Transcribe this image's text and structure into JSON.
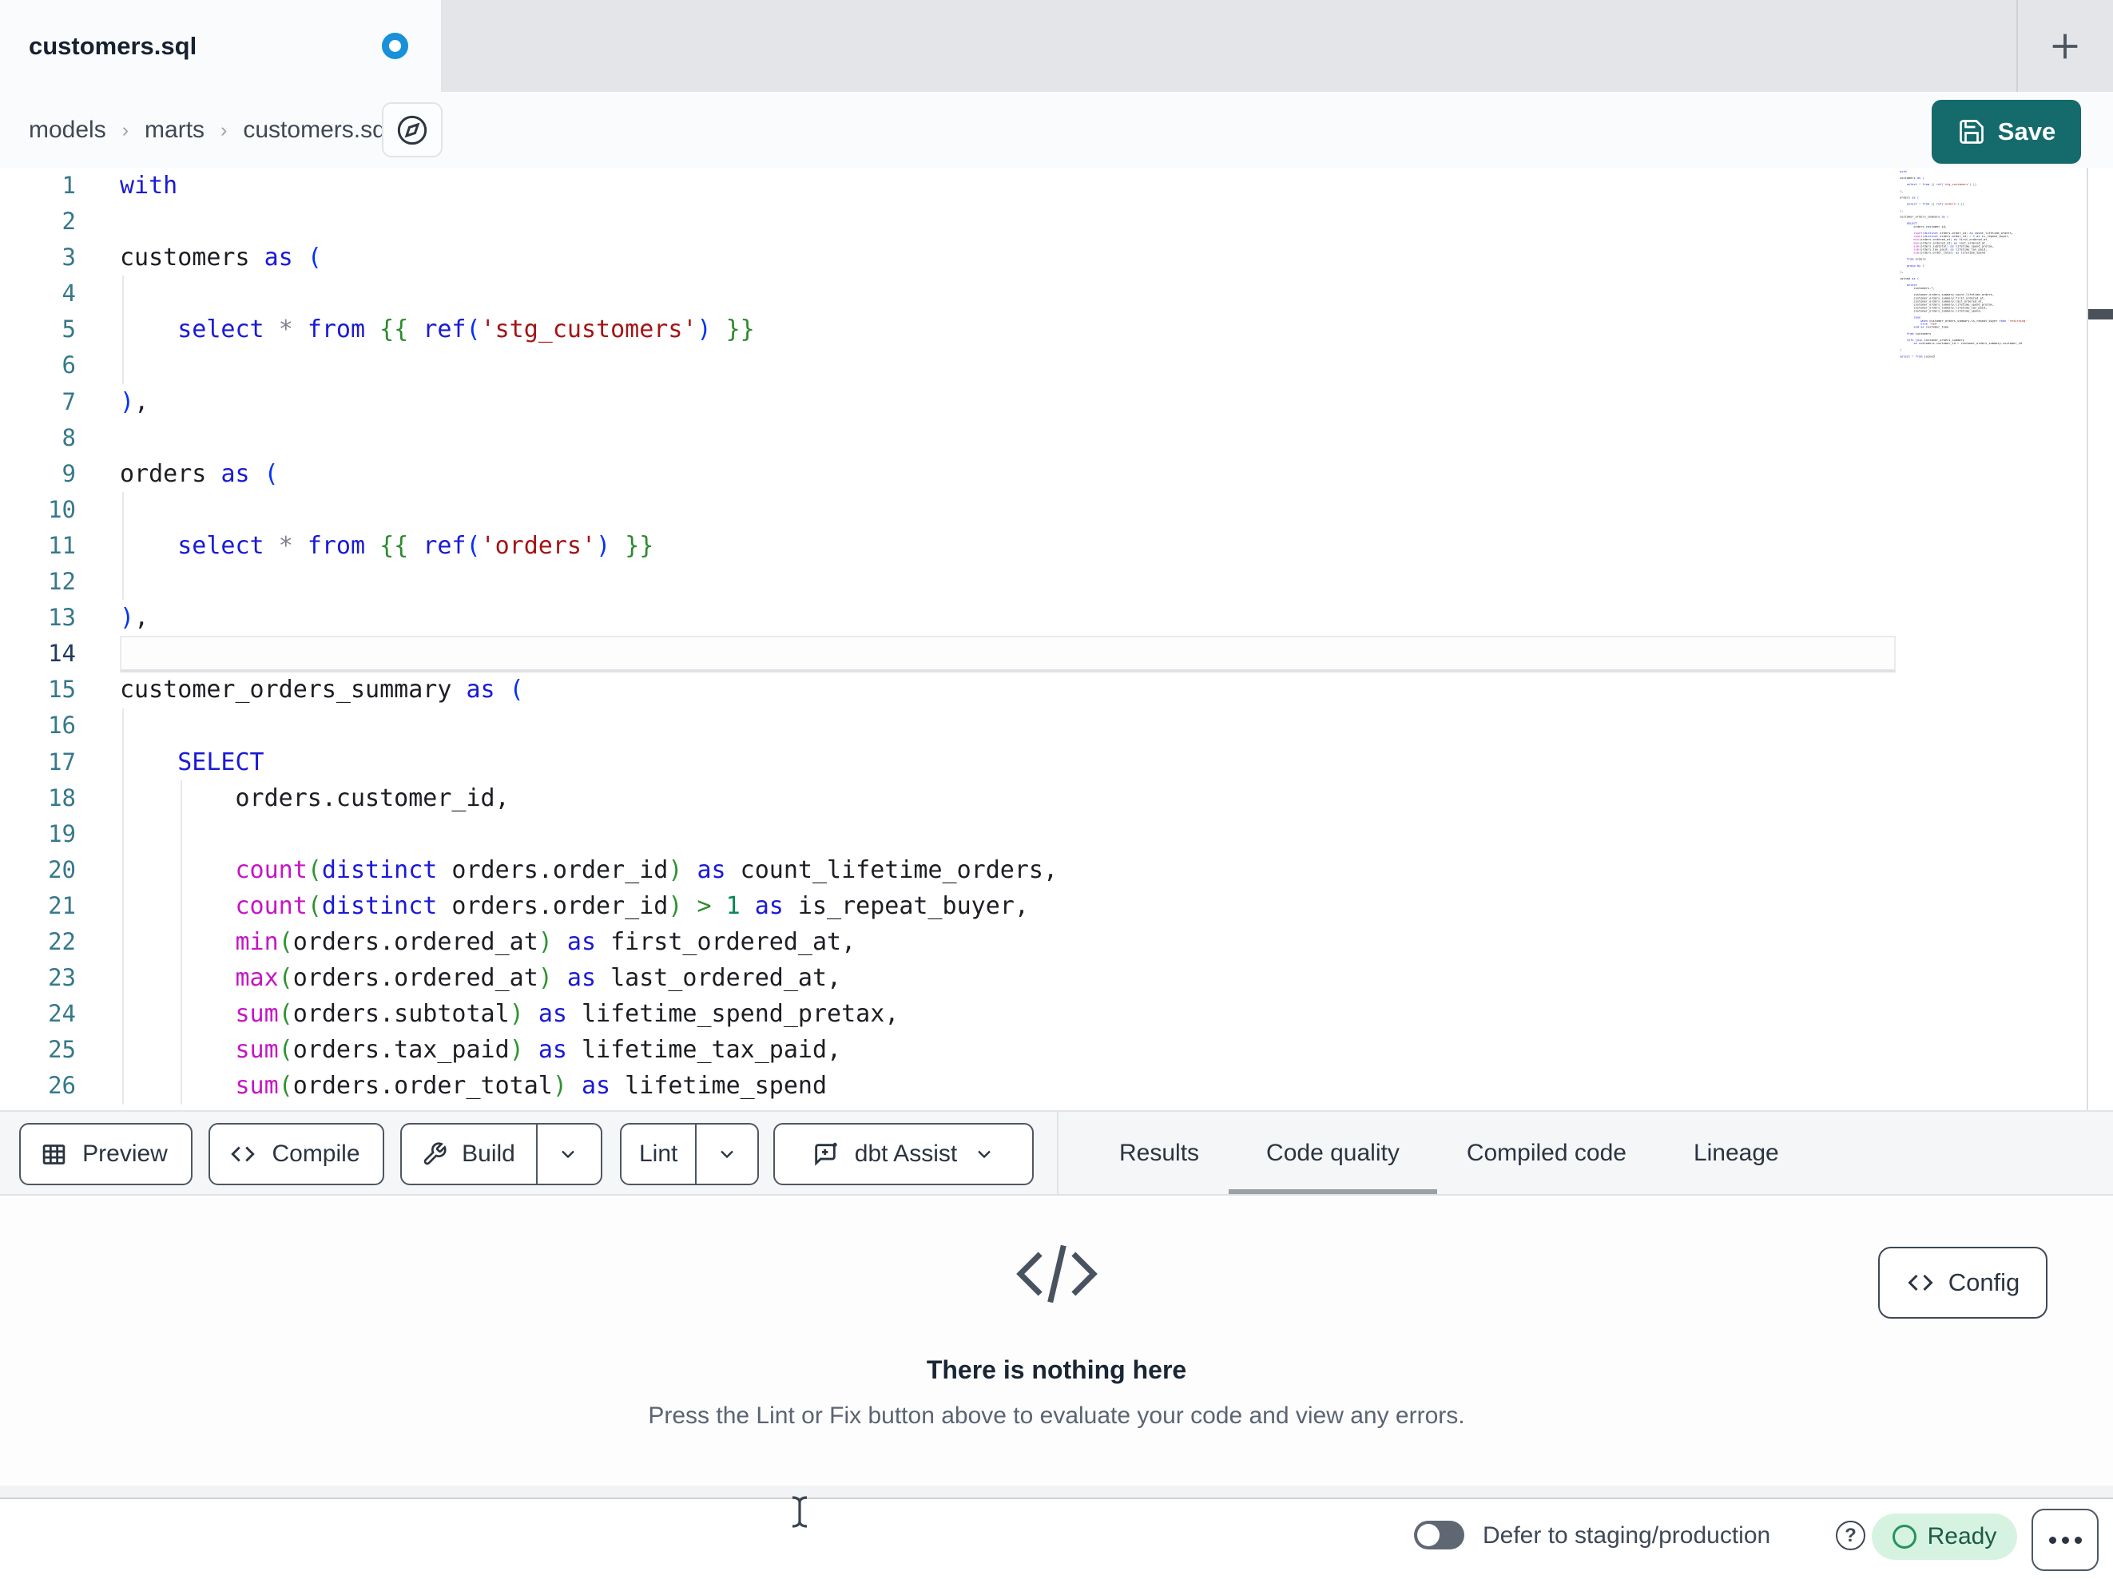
{
  "tab": {
    "title": "customers.sql",
    "modified": true
  },
  "breadcrumb": {
    "items": [
      "models",
      "marts",
      "customers.sql"
    ],
    "sep": "›"
  },
  "save_label": "Save",
  "editor": {
    "active_line": 14,
    "lines": [
      [
        [
          "kw",
          "with"
        ]
      ],
      [],
      [
        [
          "id",
          "customers "
        ],
        [
          "kw",
          "as"
        ],
        [
          "id",
          " "
        ],
        [
          "pb",
          "("
        ]
      ],
      [],
      [
        [
          "id",
          "    "
        ],
        [
          "kw",
          "select"
        ],
        [
          "id",
          " "
        ],
        [
          "op",
          "*"
        ],
        [
          "id",
          " "
        ],
        [
          "kw",
          "from"
        ],
        [
          "id",
          " "
        ],
        [
          "jinja",
          "{{"
        ],
        [
          "id",
          " "
        ],
        [
          "kw",
          "ref"
        ],
        [
          "pb",
          "("
        ],
        [
          "str",
          "'stg_customers'"
        ],
        [
          "pb",
          ")"
        ],
        [
          "id",
          " "
        ],
        [
          "jinja",
          "}}"
        ]
      ],
      [],
      [
        [
          "pb",
          ")"
        ],
        [
          "id",
          ","
        ]
      ],
      [],
      [
        [
          "id",
          "orders "
        ],
        [
          "kw",
          "as"
        ],
        [
          "id",
          " "
        ],
        [
          "pb",
          "("
        ]
      ],
      [],
      [
        [
          "id",
          "    "
        ],
        [
          "kw",
          "select"
        ],
        [
          "id",
          " "
        ],
        [
          "op",
          "*"
        ],
        [
          "id",
          " "
        ],
        [
          "kw",
          "from"
        ],
        [
          "id",
          " "
        ],
        [
          "jinja",
          "{{"
        ],
        [
          "id",
          " "
        ],
        [
          "kw",
          "ref"
        ],
        [
          "pb",
          "("
        ],
        [
          "str",
          "'orders'"
        ],
        [
          "pb",
          ")"
        ],
        [
          "id",
          " "
        ],
        [
          "jinja",
          "}}"
        ]
      ],
      [],
      [
        [
          "pb",
          ")"
        ],
        [
          "id",
          ","
        ]
      ],
      [],
      [
        [
          "id",
          "customer_orders_summary "
        ],
        [
          "kw",
          "as"
        ],
        [
          "id",
          " "
        ],
        [
          "pb",
          "("
        ]
      ],
      [],
      [
        [
          "id",
          "    "
        ],
        [
          "kw",
          "SELECT"
        ]
      ],
      [
        [
          "id",
          "        orders.customer_id,"
        ]
      ],
      [],
      [
        [
          "id",
          "        "
        ],
        [
          "fn",
          "count"
        ],
        [
          "gp",
          "("
        ],
        [
          "kw",
          "distinct"
        ],
        [
          "id",
          " orders.order_id"
        ],
        [
          "gp",
          ")"
        ],
        [
          "id",
          " "
        ],
        [
          "kw",
          "as"
        ],
        [
          "id",
          " count_lifetime_orders,"
        ]
      ],
      [
        [
          "id",
          "        "
        ],
        [
          "fn",
          "count"
        ],
        [
          "gp",
          "("
        ],
        [
          "kw",
          "distinct"
        ],
        [
          "id",
          " orders.order_id"
        ],
        [
          "gp",
          ")"
        ],
        [
          "id",
          " "
        ],
        [
          "op2",
          ">"
        ],
        [
          "id",
          " "
        ],
        [
          "num",
          "1"
        ],
        [
          "id",
          " "
        ],
        [
          "kw",
          "as"
        ],
        [
          "id",
          " is_repeat_buyer,"
        ]
      ],
      [
        [
          "id",
          "        "
        ],
        [
          "fn",
          "min"
        ],
        [
          "gp",
          "("
        ],
        [
          "id",
          "orders.ordered_at"
        ],
        [
          "gp",
          ")"
        ],
        [
          "id",
          " "
        ],
        [
          "kw",
          "as"
        ],
        [
          "id",
          " first_ordered_at,"
        ]
      ],
      [
        [
          "id",
          "        "
        ],
        [
          "fn",
          "max"
        ],
        [
          "gp",
          "("
        ],
        [
          "id",
          "orders.ordered_at"
        ],
        [
          "gp",
          ")"
        ],
        [
          "id",
          " "
        ],
        [
          "kw",
          "as"
        ],
        [
          "id",
          " last_ordered_at,"
        ]
      ],
      [
        [
          "id",
          "        "
        ],
        [
          "fn",
          "sum"
        ],
        [
          "gp",
          "("
        ],
        [
          "id",
          "orders.subtotal"
        ],
        [
          "gp",
          ")"
        ],
        [
          "id",
          " "
        ],
        [
          "kw",
          "as"
        ],
        [
          "id",
          " lifetime_spend_pretax,"
        ]
      ],
      [
        [
          "id",
          "        "
        ],
        [
          "fn",
          "sum"
        ],
        [
          "gp",
          "("
        ],
        [
          "id",
          "orders.tax_paid"
        ],
        [
          "gp",
          ")"
        ],
        [
          "id",
          " "
        ],
        [
          "kw",
          "as"
        ],
        [
          "id",
          " lifetime_tax_paid,"
        ]
      ],
      [
        [
          "id",
          "        "
        ],
        [
          "fn",
          "sum"
        ],
        [
          "gp",
          "("
        ],
        [
          "id",
          "orders.order_total"
        ],
        [
          "gp",
          ")"
        ],
        [
          "id",
          " "
        ],
        [
          "kw",
          "as"
        ],
        [
          "id",
          " lifetime_spend"
        ]
      ]
    ],
    "minimap_extra": [
      [],
      [
        [
          "id",
          "    "
        ],
        [
          "kw",
          "from"
        ],
        [
          "id",
          " orders"
        ]
      ],
      [],
      [
        [
          "id",
          "    "
        ],
        [
          "kw",
          "group by"
        ],
        [
          "id",
          " "
        ],
        [
          "num",
          "1"
        ]
      ],
      [],
      [
        [
          "pb",
          ")"
        ],
        [
          "id",
          ","
        ]
      ],
      [],
      [
        [
          "id",
          "joined "
        ],
        [
          "kw",
          "as"
        ],
        [
          "id",
          " "
        ],
        [
          "pb",
          "("
        ]
      ],
      [],
      [
        [
          "id",
          "    "
        ],
        [
          "kw",
          "select"
        ]
      ],
      [
        [
          "id",
          "        customers.*,"
        ]
      ],
      [],
      [
        [
          "id",
          "        customer_orders_summary.count_lifetime_orders,"
        ]
      ],
      [
        [
          "id",
          "        customer_orders_summary.first_ordered_at,"
        ]
      ],
      [
        [
          "id",
          "        customer_orders_summary.last_ordered_at,"
        ]
      ],
      [
        [
          "id",
          "        customer_orders_summary.lifetime_spend_pretax,"
        ]
      ],
      [
        [
          "id",
          "        customer_orders_summary.lifetime_tax_paid,"
        ]
      ],
      [
        [
          "id",
          "        customer_orders_summary.lifetime_spend,"
        ]
      ],
      [],
      [
        [
          "id",
          "        "
        ],
        [
          "kw",
          "case"
        ]
      ],
      [
        [
          "id",
          "            "
        ],
        [
          "kw",
          "when"
        ],
        [
          "id",
          " customer_orders_summary.is_repeat_buyer "
        ],
        [
          "kw",
          "then"
        ],
        [
          "id",
          " "
        ],
        [
          "str",
          "'returning'"
        ]
      ],
      [
        [
          "id",
          "            "
        ],
        [
          "kw",
          "else"
        ],
        [
          "id",
          " "
        ],
        [
          "str",
          "'new'"
        ]
      ],
      [
        [
          "id",
          "        "
        ],
        [
          "kw",
          "end"
        ],
        [
          "id",
          " "
        ],
        [
          "kw",
          "as"
        ],
        [
          "id",
          " customer_type"
        ]
      ],
      [],
      [
        [
          "id",
          "    "
        ],
        [
          "kw",
          "from"
        ],
        [
          "id",
          " customers"
        ]
      ],
      [],
      [
        [
          "id",
          "    "
        ],
        [
          "kw",
          "left join"
        ],
        [
          "id",
          " customer_orders_summary"
        ]
      ],
      [
        [
          "id",
          "        "
        ],
        [
          "kw",
          "on"
        ],
        [
          "id",
          " customers.customer_id = customer_orders_summary.customer_id"
        ]
      ],
      [],
      [
        [
          "pb",
          ")"
        ]
      ],
      [],
      [
        [
          "kw",
          "select"
        ],
        [
          "id",
          " "
        ],
        [
          "op",
          "*"
        ],
        [
          "id",
          " "
        ],
        [
          "kw",
          "from"
        ],
        [
          "id",
          " joined"
        ]
      ]
    ]
  },
  "toolbar": {
    "preview": "Preview",
    "compile": "Compile",
    "build": "Build",
    "lint": "Lint",
    "assist": "dbt Assist"
  },
  "panel_tabs": [
    {
      "label": "Results",
      "active": false
    },
    {
      "label": "Code quality",
      "active": true
    },
    {
      "label": "Compiled code",
      "active": false
    },
    {
      "label": "Lineage",
      "active": false
    }
  ],
  "empty_state": {
    "title": "There is nothing here",
    "subtitle": "Press the Lint or Fix button above to evaluate your code and view any errors."
  },
  "config_label": "Config",
  "statusbar": {
    "defer_label": "Defer to staging/production",
    "ready_label": "Ready",
    "defer_on": false
  },
  "colors": {
    "accent_teal": "#156a6c",
    "modified_dot": "#1791d8",
    "ready_bg": "#d6f3e1",
    "ready_green": "#27935c",
    "keyword_blue": "#1a1ad6",
    "string_red": "#a31515",
    "function_magenta": "#c516c5",
    "jinja_green": "#2f8a2f",
    "line_number_teal": "#36788c"
  }
}
